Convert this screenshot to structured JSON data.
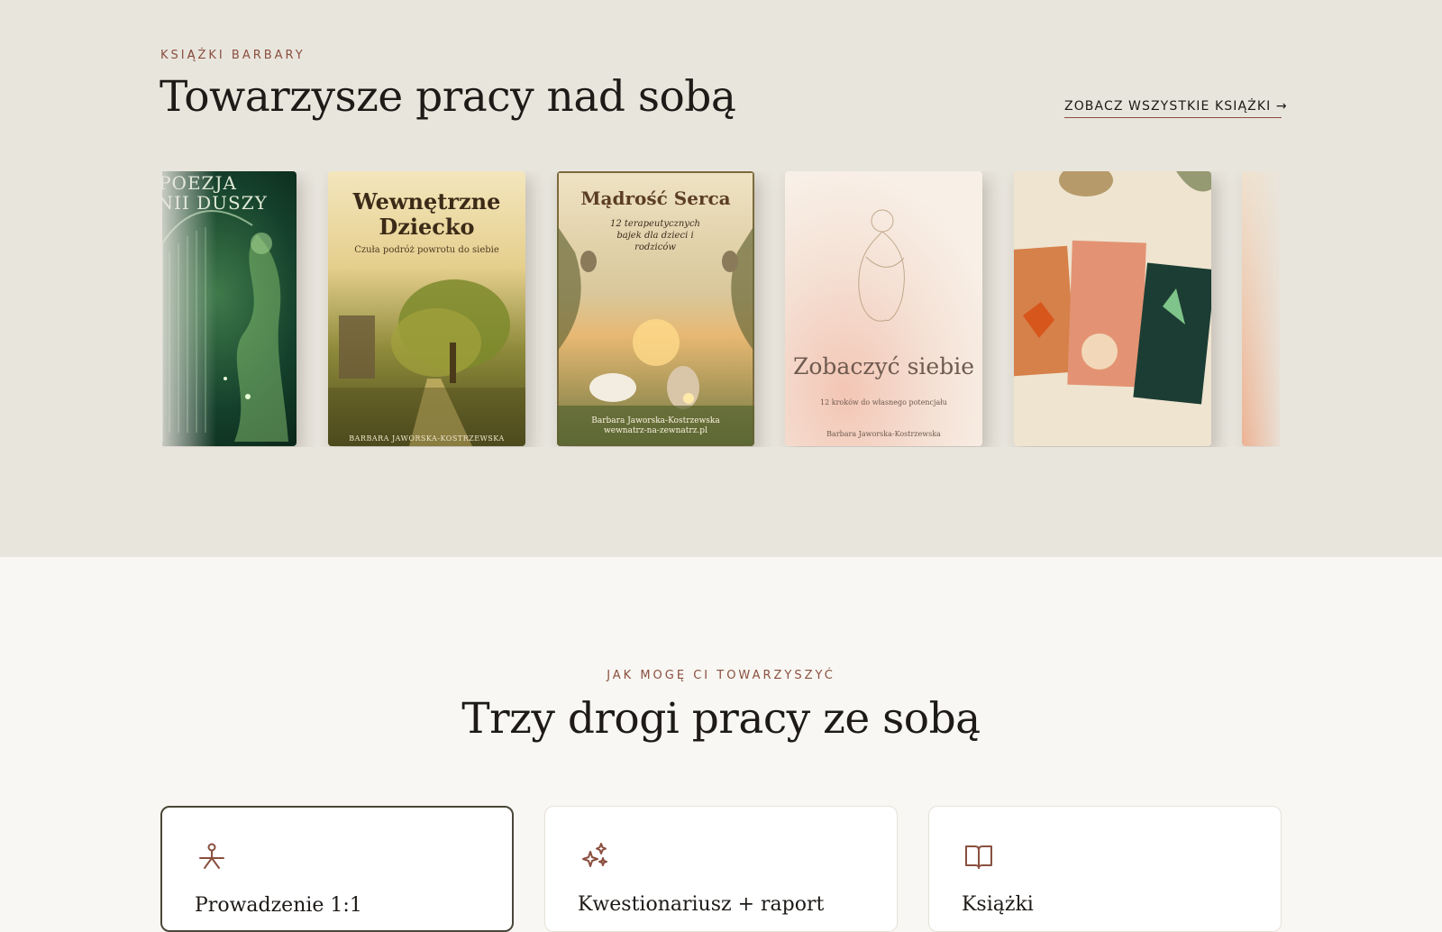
{
  "books_section": {
    "eyebrow": "KSIĄŻKI BARBARY",
    "title": "Towarzysze pracy nad sobą",
    "see_all_label": "ZOBACZ WSZYSTKIE KSIĄŻKI →",
    "books": [
      {
        "cover_lines": [
          "POEZJA",
          "FONII DUSZY"
        ]
      },
      {
        "title": "Wewnętrzne Dziecko",
        "subtitle": "Czuła podróż powrotu do siebie",
        "author": "BARBARA JAWORSKA-KOSTRZEWSKA"
      },
      {
        "title": "Mądrość Serca",
        "subtitle": "12 terapeutycznych bajek dla dzieci i rodziców",
        "author": "Barbara Jaworska-Kostrzewska",
        "site": "wewnatrz-na-zewnatrz.pl"
      },
      {
        "title": "Zobaczyć siebie",
        "subtitle": "12 kroków do własnego potencjału",
        "author": "Barbara Jaworska-Kostrzewska"
      },
      {
        "image": "book-collection-photo"
      },
      {
        "image": "partial-cover"
      }
    ]
  },
  "services_section": {
    "eyebrow": "JAK MOGĘ CI TOWARZYSZYĆ",
    "title": "Trzy drogi pracy ze sobą",
    "cards": [
      {
        "title": "Prowadzenie 1:1",
        "icon": "person-balance-icon",
        "active": true
      },
      {
        "title": "Kwestionariusz + raport",
        "icon": "sparkles-icon",
        "active": false
      },
      {
        "title": "Książki",
        "icon": "open-book-icon",
        "active": false
      }
    ]
  },
  "colors": {
    "accent": "#8a4f3f",
    "section_bg": "#e8e5dd",
    "page_bg": "#f8f7f3",
    "text": "#1d1a17"
  }
}
